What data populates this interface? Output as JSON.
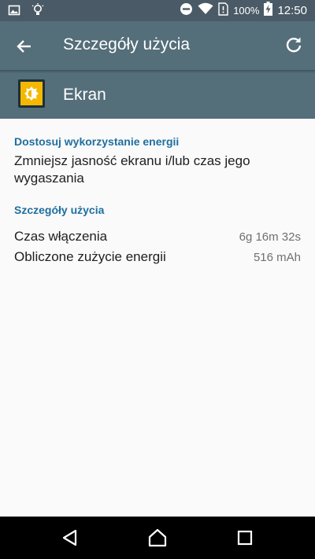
{
  "status_bar": {
    "battery_percent": "100%",
    "time": "12:50",
    "icons": [
      "image-icon",
      "lightbulb-icon",
      "do-not-disturb-icon",
      "wifi-icon",
      "sim-icon",
      "battery-charging-icon"
    ]
  },
  "toolbar": {
    "title": "Szczegóły użycia",
    "back_icon": "arrow-back-icon",
    "refresh_icon": "refresh-icon"
  },
  "app": {
    "name": "Ekran",
    "icon": "brightness-icon"
  },
  "sections": {
    "energy_heading": "Dostosuj wykorzystanie energii",
    "energy_tip": "Zmniejsz jasność ekranu i/lub czas jego wygaszania",
    "usage_heading": "Szczegóły użycia",
    "rows": [
      {
        "label": "Czas włączenia",
        "value": "6g 16m 32s"
      },
      {
        "label": "Obliczone zużycie energii",
        "value": "516 mAh"
      }
    ]
  },
  "nav_bar": {
    "icons": [
      "back-triangle-icon",
      "home-icon",
      "recents-icon"
    ]
  },
  "colors": {
    "toolbar": "#546e7a",
    "status_bar": "#4a5a66",
    "accent": "#1e6fa0",
    "app_icon": "#f5b800"
  }
}
